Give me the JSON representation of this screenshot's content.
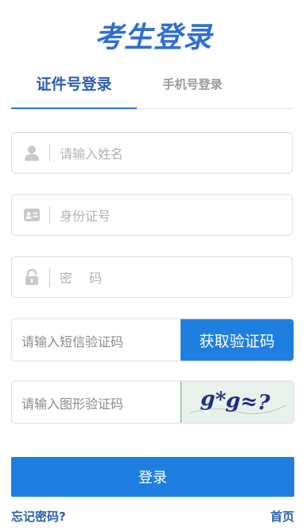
{
  "header": {
    "title": "考生登录"
  },
  "tabs": [
    {
      "label": "证件号登录",
      "active": true
    },
    {
      "label": "手机号登录",
      "active": false
    }
  ],
  "form": {
    "name_placeholder": "请输入姓名",
    "id_placeholder": "身份证号",
    "password_placeholder": "密 码",
    "sms_placeholder": "请输入短信验证码",
    "sms_button": "获取验证码",
    "captcha_placeholder": "请输入图形验证码",
    "captcha_text": "g*g≈?",
    "login_button": "登录"
  },
  "footer": {
    "forgot_link": "忘记密码?",
    "home_link": "首页"
  },
  "colors": {
    "accent": "#1f7fe0",
    "title": "#2f6fd0",
    "link": "#2b5fb0"
  },
  "icons": [
    "user-icon",
    "id-card-icon",
    "lock-icon"
  ]
}
